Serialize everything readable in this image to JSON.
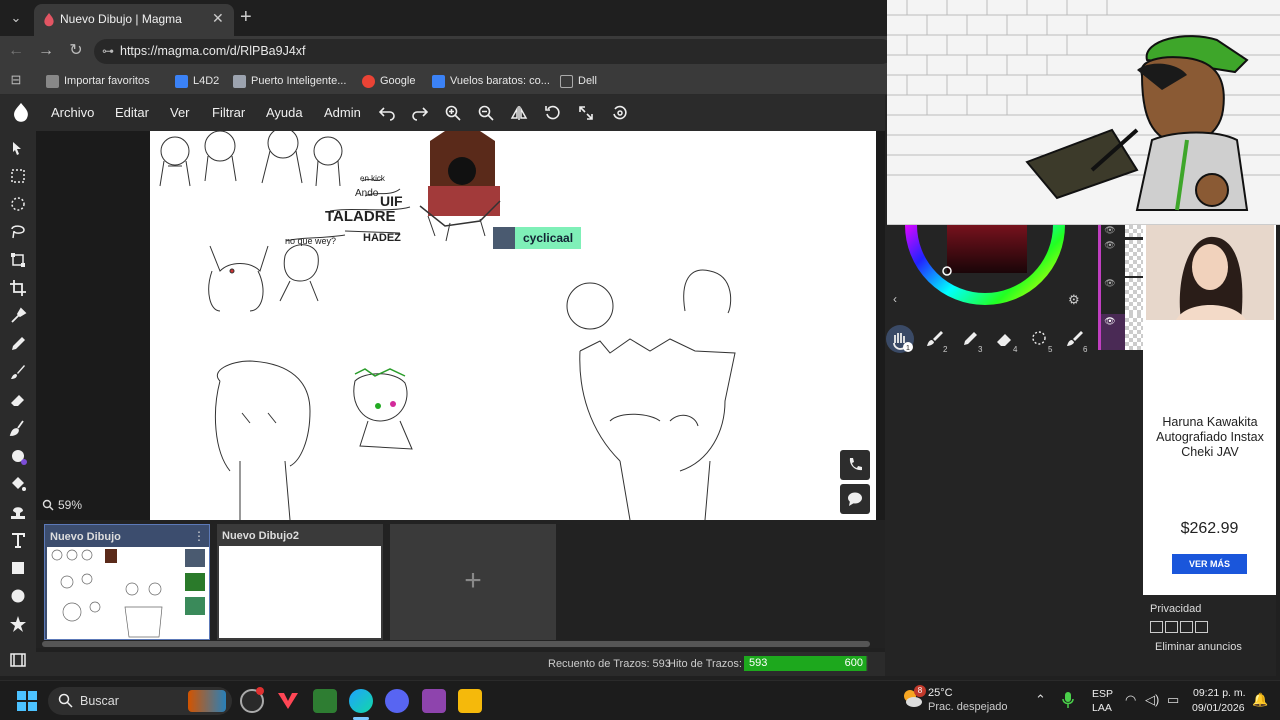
{
  "browser": {
    "tab": {
      "title": "Nuevo Dibujo | Magma"
    },
    "url": "https://magma.com/d/RlPBa9J4xf",
    "bookmarks": [
      {
        "label": "Importar favoritos",
        "icon": "import-icon",
        "color": "#aaaaaa"
      },
      {
        "label": "L4D2",
        "icon": "l4d2-icon",
        "color": "#3b82f6"
      },
      {
        "label": "Puerto Inteligente...",
        "icon": "port-icon",
        "color": "#9ca3af"
      },
      {
        "label": "Google",
        "icon": "google-icon",
        "color": "#ea4335"
      },
      {
        "label": "Vuelos baratos: co...",
        "icon": "flight-icon",
        "color": "#3b82f6"
      },
      {
        "label": "Dell",
        "icon": "folder-icon",
        "color": "#aaaaaa"
      }
    ]
  },
  "app": {
    "menu": [
      "Archivo",
      "Editar",
      "Ver",
      "Filtrar",
      "Ayuda",
      "Admin"
    ],
    "toolbar_icons": [
      "undo-icon",
      "redo-icon",
      "zoom-in-icon",
      "zoom-out-icon",
      "flip-icon",
      "rotate-icon",
      "fullscreen-icon",
      "settings-icon"
    ],
    "zoom": "59%",
    "collaborator": "cyclicaal",
    "drawings": [
      {
        "title": "Nuevo Dibujo",
        "active": true
      },
      {
        "title": "Nuevo Dibujo2",
        "active": false
      }
    ],
    "add_drawing": "+",
    "status": {
      "stroke_count_label": "Recuento de Trazos: 593",
      "stroke_limit_label": "Hito de Trazos:",
      "current": "593",
      "max": "600",
      "progress": 0.988
    },
    "brushes": [
      "1",
      "2",
      "3",
      "4",
      "5",
      "6"
    ],
    "accent": "#7ff0b8"
  },
  "ad": {
    "title": "Haruna Kawakita Autografiado Instax Cheki JAV",
    "price": "$262.99",
    "button": "VER MÁS",
    "privacy": "Privacidad",
    "remove_ads": "Eliminar anuncios"
  },
  "taskbar": {
    "search": "Buscar",
    "weather_badge": "8",
    "temperature": "25°C",
    "weather": "Prac. despejado",
    "lang_top": "ESP",
    "lang_bottom": "LAA",
    "time": "09:21 p. m.",
    "date": "09/01/2026"
  }
}
